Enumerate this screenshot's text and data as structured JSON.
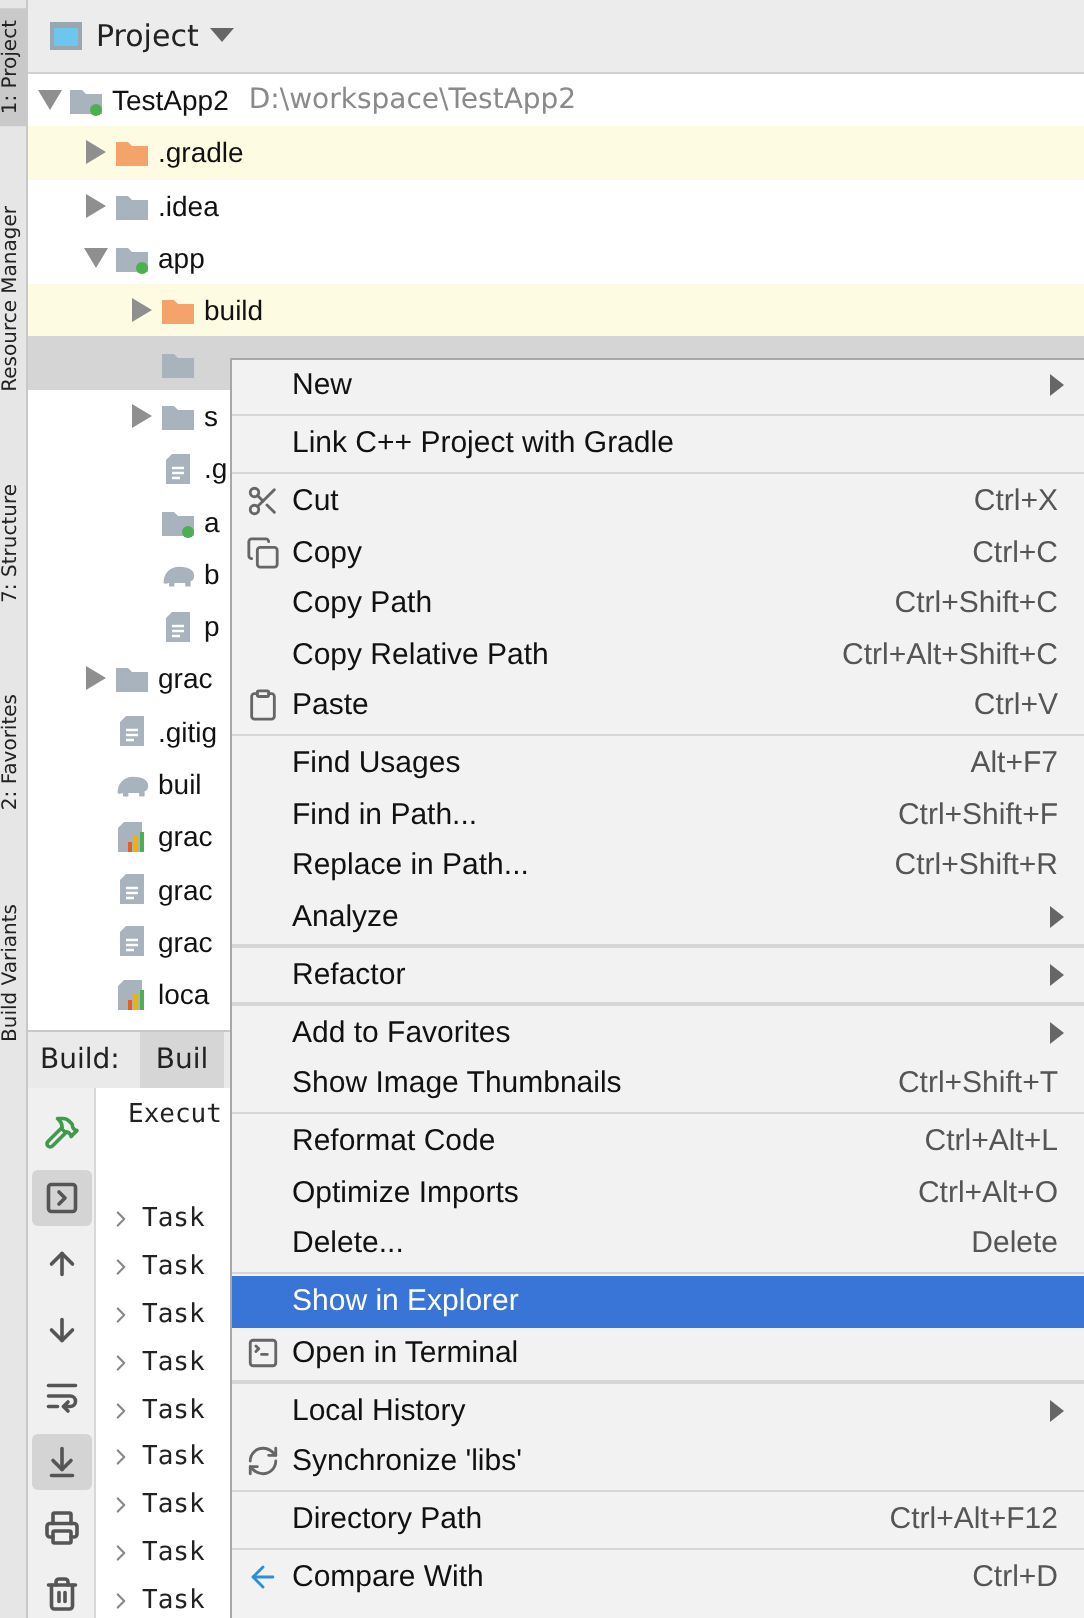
{
  "side_strip": [
    {
      "label": "1: Project",
      "selected": true
    },
    {
      "label": "Resource Manager",
      "selected": false
    },
    {
      "label": "7: Structure",
      "selected": false
    },
    {
      "label": "2: Favorites",
      "selected": false
    },
    {
      "label": "Build Variants",
      "selected": false
    }
  ],
  "project": {
    "title": "Project",
    "tree": [
      {
        "name": "TestApp2",
        "path": "D:\\workspace\\TestApp2",
        "kind": "module",
        "expanded": true,
        "selected": false,
        "children": [
          {
            "name": ".gradle",
            "kind": "excluded",
            "expanded": false,
            "selected": false
          },
          {
            "name": ".idea",
            "kind": "folder",
            "expanded": false,
            "selected": false
          },
          {
            "name": "app",
            "kind": "module",
            "expanded": true,
            "selected": false,
            "children": [
              {
                "name": "build",
                "kind": "excluded",
                "expanded": false,
                "selected": false
              },
              {
                "kind": "folder",
                "selected": true
              },
              {
                "name": "s",
                "kind": "folder",
                "expanded": false,
                "selected": false
              },
              {
                "name": ".g",
                "kind": "file",
                "selected": false
              },
              {
                "name": "a",
                "kind": "module",
                "selected": false
              },
              {
                "name": "b",
                "kind": "gradle",
                "selected": false
              },
              {
                "name": "p",
                "kind": "file",
                "selected": false
              }
            ]
          },
          {
            "name": "grac",
            "kind": "folder",
            "expanded": false,
            "selected": false
          },
          {
            "name": ".gitig",
            "kind": "file",
            "selected": false
          },
          {
            "name": "buil",
            "kind": "gradle",
            "selected": false
          },
          {
            "name": "grac",
            "kind": "chart",
            "selected": false
          },
          {
            "name": "grac",
            "kind": "file",
            "selected": false
          },
          {
            "name": "grac",
            "kind": "file",
            "selected": false
          },
          {
            "name": "loca",
            "kind": "chart",
            "selected": false
          }
        ]
      }
    ]
  },
  "build": {
    "label": "Build:",
    "tabs": [
      {
        "label": "Buil",
        "selected": true
      }
    ],
    "toolbar": [
      {
        "on": false
      },
      {
        "on": true
      },
      {
        "on": false
      },
      {
        "on": false
      },
      {
        "on": false
      },
      {
        "on": true
      },
      {
        "on": false
      },
      {
        "on": false
      }
    ],
    "header": "Execut",
    "tasks": [
      "Task",
      "Task",
      "Task",
      "Task",
      "Task",
      "Task",
      "Task",
      "Task",
      "Task"
    ]
  },
  "context_menu": [
    {
      "kind": "item",
      "label": "New",
      "submenu": true,
      "selected": false
    },
    {
      "kind": "separator"
    },
    {
      "kind": "item",
      "label": "Link C++ Project with Gradle",
      "selected": false
    },
    {
      "kind": "separator"
    },
    {
      "kind": "item",
      "label": "Cut",
      "shortcut": "Ctrl+X",
      "selected": false
    },
    {
      "kind": "item",
      "label": "Copy",
      "shortcut": "Ctrl+C",
      "selected": false
    },
    {
      "kind": "item",
      "label": "Copy Path",
      "shortcut": "Ctrl+Shift+C",
      "selected": false
    },
    {
      "kind": "item",
      "label": "Copy Relative Path",
      "shortcut": "Ctrl+Alt+Shift+C",
      "selected": false
    },
    {
      "kind": "item",
      "label": "Paste",
      "shortcut": "Ctrl+V",
      "selected": false
    },
    {
      "kind": "separator"
    },
    {
      "kind": "item",
      "label": "Find Usages",
      "shortcut": "Alt+F7",
      "selected": false
    },
    {
      "kind": "item",
      "label": "Find in Path...",
      "shortcut": "Ctrl+Shift+F",
      "selected": false
    },
    {
      "kind": "item",
      "label": "Replace in Path...",
      "shortcut": "Ctrl+Shift+R",
      "selected": false
    },
    {
      "kind": "item",
      "label": "Analyze",
      "submenu": true,
      "selected": false
    },
    {
      "kind": "separator"
    },
    {
      "kind": "item",
      "label": "Refactor",
      "submenu": true,
      "selected": false
    },
    {
      "kind": "separator"
    },
    {
      "kind": "item",
      "label": "Add to Favorites",
      "submenu": true,
      "selected": false
    },
    {
      "kind": "item",
      "label": "Show Image Thumbnails",
      "shortcut": "Ctrl+Shift+T",
      "selected": false
    },
    {
      "kind": "separator"
    },
    {
      "kind": "item",
      "label": "Reformat Code",
      "shortcut": "Ctrl+Alt+L",
      "selected": false
    },
    {
      "kind": "item",
      "label": "Optimize Imports",
      "shortcut": "Ctrl+Alt+O",
      "selected": false
    },
    {
      "kind": "item",
      "label": "Delete...",
      "shortcut": "Delete",
      "selected": false
    },
    {
      "kind": "separator"
    },
    {
      "kind": "item",
      "label": "Show in Explorer",
      "selected": true
    },
    {
      "kind": "item",
      "label": "Open in Terminal",
      "selected": false
    },
    {
      "kind": "separator"
    },
    {
      "kind": "item",
      "label": "Local History",
      "submenu": true,
      "selected": false
    },
    {
      "kind": "item",
      "label": "Synchronize 'libs'",
      "selected": false
    },
    {
      "kind": "separator"
    },
    {
      "kind": "item",
      "label": "Directory Path",
      "shortcut": "Ctrl+Alt+F12",
      "selected": false
    },
    {
      "kind": "separator"
    },
    {
      "kind": "item",
      "label": "Compare With",
      "shortcut": "Ctrl+D",
      "selected": false
    }
  ]
}
